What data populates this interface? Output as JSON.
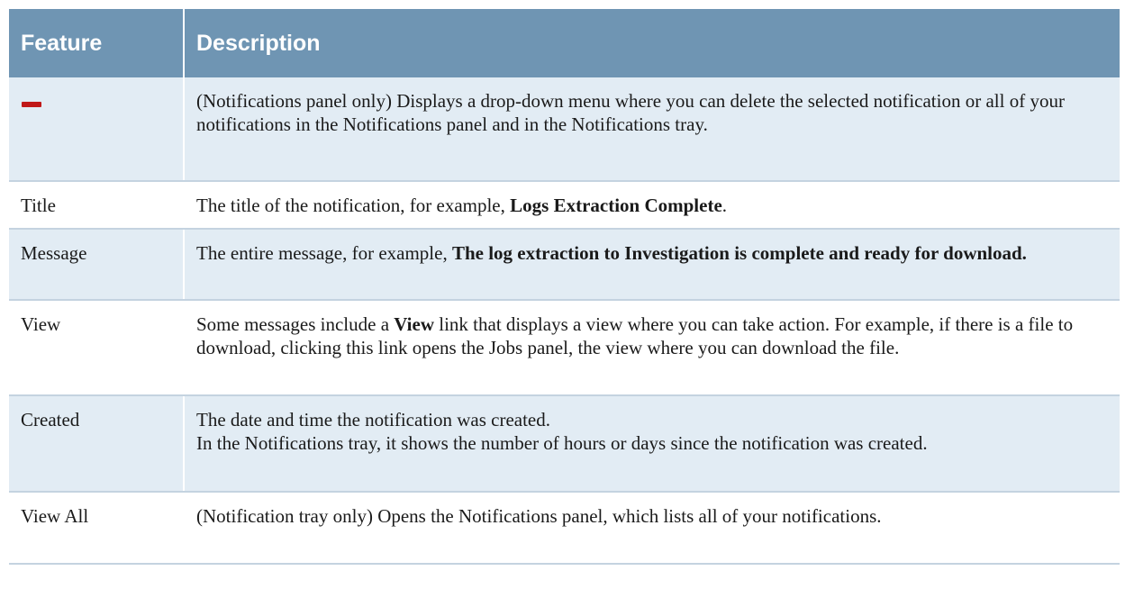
{
  "table": {
    "headers": {
      "feature": "Feature",
      "description": "Description"
    },
    "rows": [
      {
        "feature_icon": "minus-icon",
        "description": "(Notifications panel only) Displays a drop-down menu where you can delete the selected notification or all of your notifications in the Notifications panel and in the Notifications tray."
      },
      {
        "feature": "Title",
        "description_pre": "The title of the notification, for example, ",
        "description_bold": "Logs Extraction Complete",
        "description_post": "."
      },
      {
        "feature": "Message",
        "description_pre": "The entire message, for example, ",
        "description_bold": "The log extraction to Investigation is complete and ready for download."
      },
      {
        "feature": "View",
        "description_pre": "Some messages include a ",
        "description_bold": "View",
        "description_post": " link that displays a view where you can take action. For example, if there is a file to download, clicking this link opens the Jobs panel, the view where you can download the file."
      },
      {
        "feature": "Created",
        "description_line1": "The date and time the notification was created.",
        "description_line2": "In the Notifications tray, it shows the number of hours or days since the notification was created."
      },
      {
        "feature": "View All",
        "description": "(Notification tray only) Opens the Notifications panel, which lists all of your notifications."
      }
    ]
  },
  "colors": {
    "header_bg": "#6f95b3",
    "odd_row_bg": "#e2ecf4",
    "even_row_bg": "#ffffff",
    "minus_icon": "#c01818"
  }
}
